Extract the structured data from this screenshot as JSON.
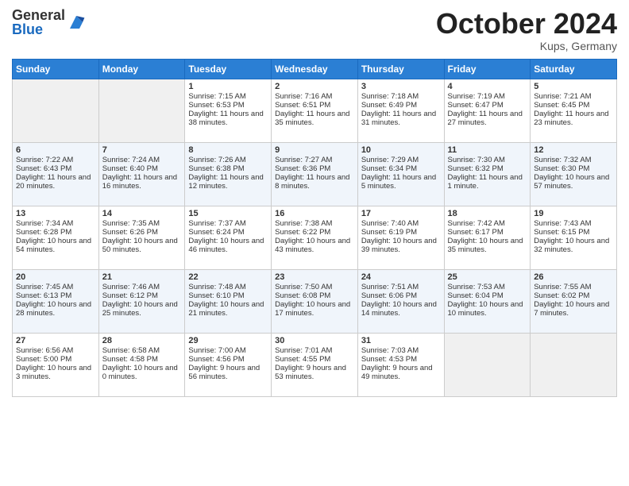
{
  "header": {
    "logo_general": "General",
    "logo_blue": "Blue",
    "month_title": "October 2024",
    "subtitle": "Kups, Germany"
  },
  "days_of_week": [
    "Sunday",
    "Monday",
    "Tuesday",
    "Wednesday",
    "Thursday",
    "Friday",
    "Saturday"
  ],
  "weeks": [
    [
      {
        "day": "",
        "content": ""
      },
      {
        "day": "",
        "content": ""
      },
      {
        "day": "1",
        "content": "Sunrise: 7:15 AM\nSunset: 6:53 PM\nDaylight: 11 hours and 38 minutes."
      },
      {
        "day": "2",
        "content": "Sunrise: 7:16 AM\nSunset: 6:51 PM\nDaylight: 11 hours and 35 minutes."
      },
      {
        "day": "3",
        "content": "Sunrise: 7:18 AM\nSunset: 6:49 PM\nDaylight: 11 hours and 31 minutes."
      },
      {
        "day": "4",
        "content": "Sunrise: 7:19 AM\nSunset: 6:47 PM\nDaylight: 11 hours and 27 minutes."
      },
      {
        "day": "5",
        "content": "Sunrise: 7:21 AM\nSunset: 6:45 PM\nDaylight: 11 hours and 23 minutes."
      }
    ],
    [
      {
        "day": "6",
        "content": "Sunrise: 7:22 AM\nSunset: 6:43 PM\nDaylight: 11 hours and 20 minutes."
      },
      {
        "day": "7",
        "content": "Sunrise: 7:24 AM\nSunset: 6:40 PM\nDaylight: 11 hours and 16 minutes."
      },
      {
        "day": "8",
        "content": "Sunrise: 7:26 AM\nSunset: 6:38 PM\nDaylight: 11 hours and 12 minutes."
      },
      {
        "day": "9",
        "content": "Sunrise: 7:27 AM\nSunset: 6:36 PM\nDaylight: 11 hours and 8 minutes."
      },
      {
        "day": "10",
        "content": "Sunrise: 7:29 AM\nSunset: 6:34 PM\nDaylight: 11 hours and 5 minutes."
      },
      {
        "day": "11",
        "content": "Sunrise: 7:30 AM\nSunset: 6:32 PM\nDaylight: 11 hours and 1 minute."
      },
      {
        "day": "12",
        "content": "Sunrise: 7:32 AM\nSunset: 6:30 PM\nDaylight: 10 hours and 57 minutes."
      }
    ],
    [
      {
        "day": "13",
        "content": "Sunrise: 7:34 AM\nSunset: 6:28 PM\nDaylight: 10 hours and 54 minutes."
      },
      {
        "day": "14",
        "content": "Sunrise: 7:35 AM\nSunset: 6:26 PM\nDaylight: 10 hours and 50 minutes."
      },
      {
        "day": "15",
        "content": "Sunrise: 7:37 AM\nSunset: 6:24 PM\nDaylight: 10 hours and 46 minutes."
      },
      {
        "day": "16",
        "content": "Sunrise: 7:38 AM\nSunset: 6:22 PM\nDaylight: 10 hours and 43 minutes."
      },
      {
        "day": "17",
        "content": "Sunrise: 7:40 AM\nSunset: 6:19 PM\nDaylight: 10 hours and 39 minutes."
      },
      {
        "day": "18",
        "content": "Sunrise: 7:42 AM\nSunset: 6:17 PM\nDaylight: 10 hours and 35 minutes."
      },
      {
        "day": "19",
        "content": "Sunrise: 7:43 AM\nSunset: 6:15 PM\nDaylight: 10 hours and 32 minutes."
      }
    ],
    [
      {
        "day": "20",
        "content": "Sunrise: 7:45 AM\nSunset: 6:13 PM\nDaylight: 10 hours and 28 minutes."
      },
      {
        "day": "21",
        "content": "Sunrise: 7:46 AM\nSunset: 6:12 PM\nDaylight: 10 hours and 25 minutes."
      },
      {
        "day": "22",
        "content": "Sunrise: 7:48 AM\nSunset: 6:10 PM\nDaylight: 10 hours and 21 minutes."
      },
      {
        "day": "23",
        "content": "Sunrise: 7:50 AM\nSunset: 6:08 PM\nDaylight: 10 hours and 17 minutes."
      },
      {
        "day": "24",
        "content": "Sunrise: 7:51 AM\nSunset: 6:06 PM\nDaylight: 10 hours and 14 minutes."
      },
      {
        "day": "25",
        "content": "Sunrise: 7:53 AM\nSunset: 6:04 PM\nDaylight: 10 hours and 10 minutes."
      },
      {
        "day": "26",
        "content": "Sunrise: 7:55 AM\nSunset: 6:02 PM\nDaylight: 10 hours and 7 minutes."
      }
    ],
    [
      {
        "day": "27",
        "content": "Sunrise: 6:56 AM\nSunset: 5:00 PM\nDaylight: 10 hours and 3 minutes."
      },
      {
        "day": "28",
        "content": "Sunrise: 6:58 AM\nSunset: 4:58 PM\nDaylight: 10 hours and 0 minutes."
      },
      {
        "day": "29",
        "content": "Sunrise: 7:00 AM\nSunset: 4:56 PM\nDaylight: 9 hours and 56 minutes."
      },
      {
        "day": "30",
        "content": "Sunrise: 7:01 AM\nSunset: 4:55 PM\nDaylight: 9 hours and 53 minutes."
      },
      {
        "day": "31",
        "content": "Sunrise: 7:03 AM\nSunset: 4:53 PM\nDaylight: 9 hours and 49 minutes."
      },
      {
        "day": "",
        "content": ""
      },
      {
        "day": "",
        "content": ""
      }
    ]
  ]
}
